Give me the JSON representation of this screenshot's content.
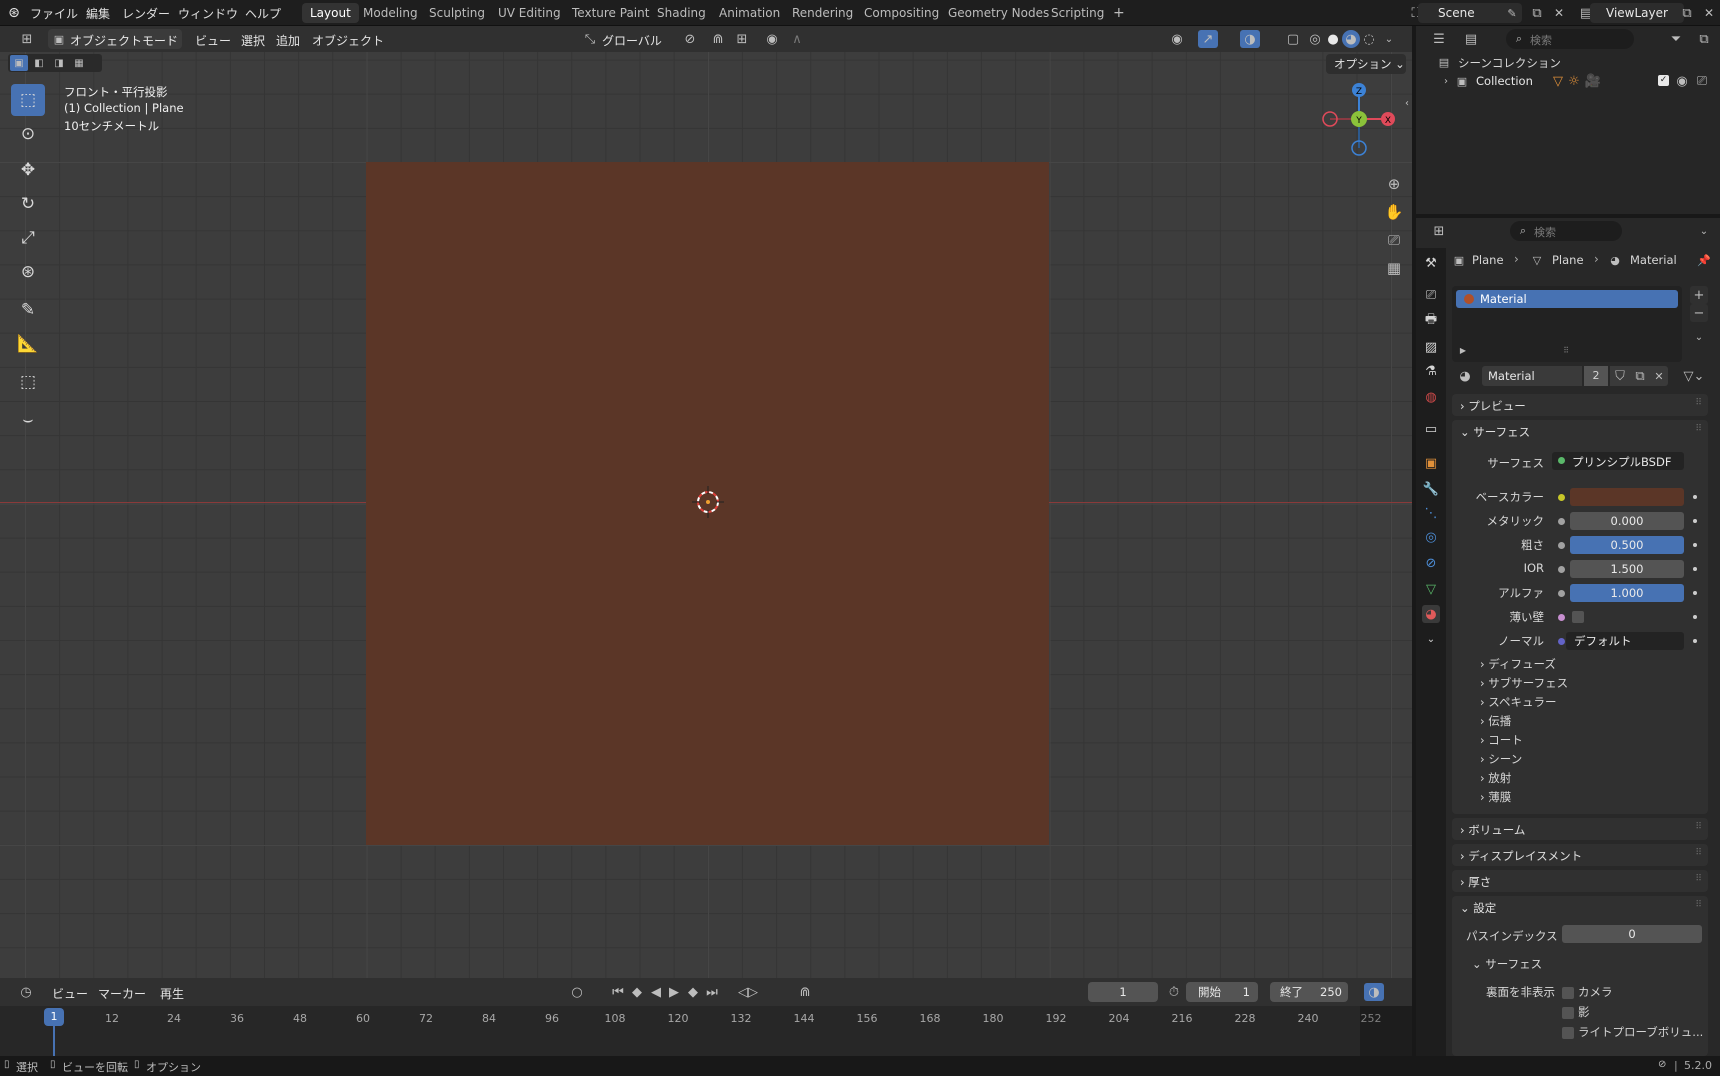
{
  "menus": [
    "ファイル",
    "編集",
    "レンダー",
    "ウィンドウ",
    "ヘルプ"
  ],
  "workspaces": [
    "Layout",
    "Modeling",
    "Sculpting",
    "UV Editing",
    "Texture Paint",
    "Shading",
    "Animation",
    "Rendering",
    "Compositing",
    "Geometry Nodes",
    "Scripting"
  ],
  "add_workspace": "+",
  "scene_name": "Scene",
  "view_layer": "ViewLayer",
  "viewport_header": {
    "mode": "オブジェクトモード",
    "view": "ビュー",
    "select": "選択",
    "add": "追加",
    "object": "オブジェクト",
    "transform": "グローバル",
    "options": "オプション"
  },
  "viewport_overlay": {
    "view_name": "フロント・平行投影",
    "collection_info": "(1) Collection | Plane",
    "scale": "10センチメートル"
  },
  "gizmo": {
    "z": "Z",
    "y": "Y",
    "x": "X"
  },
  "outliner": {
    "search_placeholder": "検索",
    "scene_collection": "シーンコレクション",
    "collection": "Collection"
  },
  "properties": {
    "search_placeholder": "検索",
    "breadcrumb": [
      "Plane",
      "Plane",
      "Material"
    ],
    "slot": "Material",
    "material_name": "Material",
    "users": "2",
    "sections": {
      "preview": "プレビュー",
      "surface": "サーフェス",
      "volume": "ボリューム",
      "displacement": "ディスプレイスメント",
      "thickness": "厚さ",
      "settings": "設定"
    },
    "surface_label": "サーフェス",
    "surface_shader": "プリンシプルBSDF",
    "inputs": [
      {
        "label": "ベースカラー",
        "value": "",
        "color": "#5b3627"
      },
      {
        "label": "メタリック",
        "value": "0.000",
        "fill": 0
      },
      {
        "label": "粗さ",
        "value": "0.500",
        "fill": 1
      },
      {
        "label": "IOR",
        "value": "1.500",
        "fill": 0
      },
      {
        "label": "アルファ",
        "value": "1.000",
        "fill": 1
      },
      {
        "label": "薄い壁",
        "value": ""
      },
      {
        "label": "ノーマル",
        "value": "デフォルト"
      }
    ],
    "subpanels": [
      "ディフューズ",
      "サブサーフェス",
      "スペキュラー",
      "伝播",
      "コート",
      "シーン",
      "放射",
      "薄膜"
    ],
    "pass_index_label": "パスインデックス",
    "pass_index": "0",
    "settings_surface": "サーフェス",
    "backface_label": "裏面を非表示",
    "backface_opts": [
      "カメラ",
      "影",
      "ライトプローブボリュ..."
    ]
  },
  "timeline": {
    "view": "ビュー",
    "marker": "マーカー",
    "playback": "再生",
    "current_frame": "1",
    "start_label": "開始",
    "start": "1",
    "end_label": "終了",
    "end": "250",
    "ticks": [
      "1",
      "12",
      "24",
      "36",
      "48",
      "60",
      "72",
      "84",
      "96",
      "108",
      "120",
      "132",
      "144",
      "156",
      "168",
      "180",
      "192",
      "204",
      "216",
      "228",
      "240",
      "252"
    ]
  },
  "statusbar": {
    "select": "選択",
    "rotate_view": "ビューを回転",
    "options": "オプション",
    "version": "5.2.0"
  },
  "colors": {
    "accent": "#4772b3",
    "plane": "#5b3627",
    "x_axis": "#e04a5a",
    "y_axis": "#8bc23a",
    "z_axis": "#3c82d6"
  }
}
